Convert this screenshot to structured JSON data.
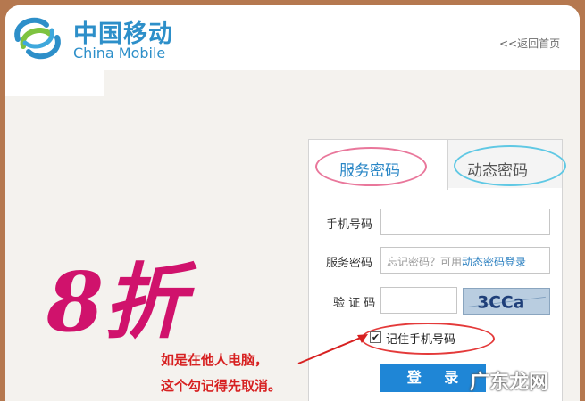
{
  "brand": {
    "name_cn": "中国移动",
    "name_en": "China Mobile"
  },
  "header": {
    "back_link": "<<返回首页"
  },
  "promo": {
    "text": "8折"
  },
  "login": {
    "tabs": [
      {
        "label": "服务密码",
        "active": true
      },
      {
        "label": "动态密码",
        "active": false
      }
    ],
    "phone_label": "手机号码",
    "phone_value": "",
    "password_label": "服务密码",
    "password_hint": "忘记密码？可用",
    "password_hint_link": "动态密码登录",
    "captcha_label": "验 证 码",
    "captcha_value": "",
    "captcha_image_text": "3CCa",
    "remember_label": "记住手机号码",
    "remember_checked": true,
    "submit_label": "登 录"
  },
  "annotation": {
    "line1": "如是在他人电脑，",
    "line2": "这个勾记得先取消。"
  },
  "watermark": "广东龙网",
  "colors": {
    "brand_blue": "#2d8fc9",
    "promo_magenta": "#d0126c",
    "button_blue": "#1f86d6",
    "annotation_red": "#d72121",
    "frame_brown": "#b5784f"
  }
}
